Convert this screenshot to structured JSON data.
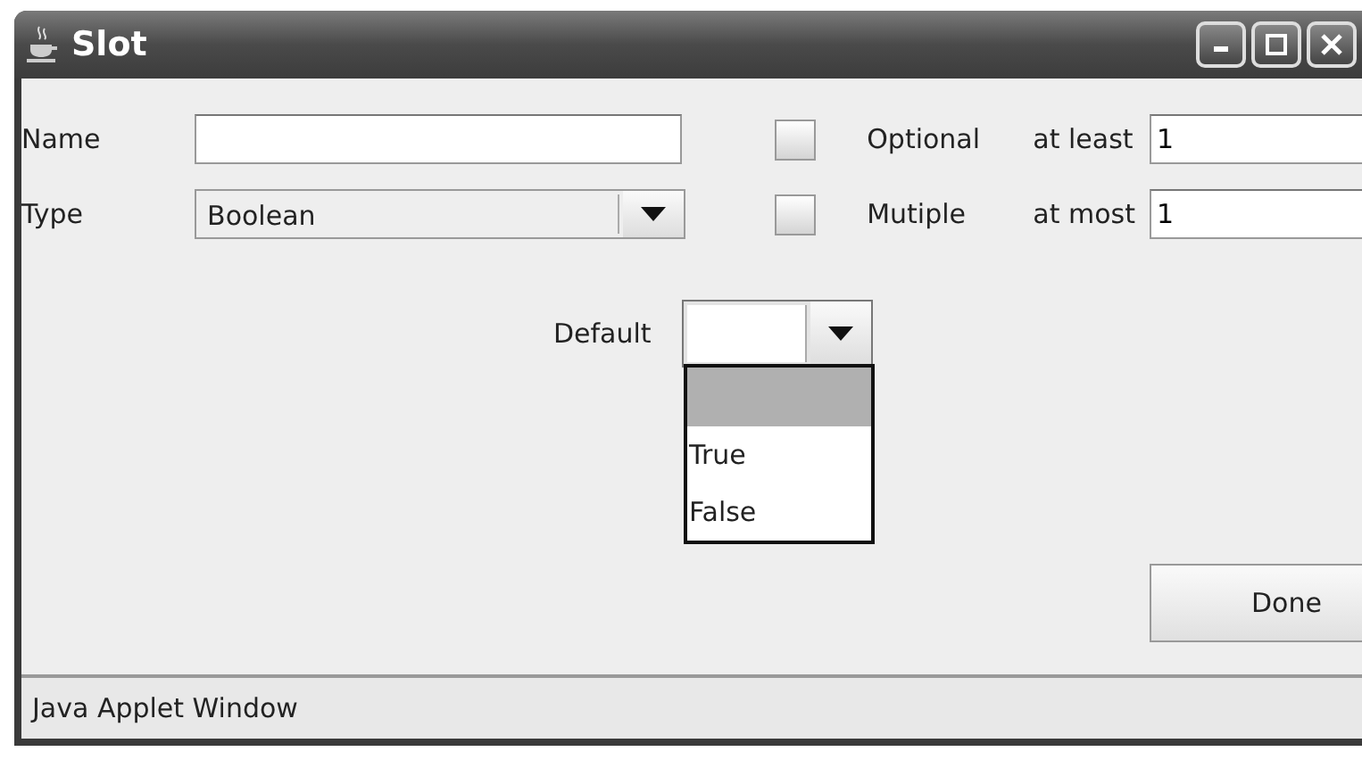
{
  "window": {
    "title": "Slot"
  },
  "name_field": {
    "label": "Name"
  },
  "type_field": {
    "label": "Type",
    "value": "Boolean"
  },
  "optional": {
    "label": "Optional",
    "checked": false
  },
  "multiple": {
    "label": "Mutiple",
    "checked": false
  },
  "at_least": {
    "label": "at least",
    "value": "1"
  },
  "at_most": {
    "label": "at most",
    "value": "1"
  },
  "default_field": {
    "label": "Default",
    "expanded": true,
    "options": [
      {
        "selected": true
      },
      {
        "label": "True",
        "selected": false
      },
      {
        "label": "False",
        "selected": false
      }
    ]
  },
  "done_button": "Done",
  "status_bar": "Java Applet Window"
}
